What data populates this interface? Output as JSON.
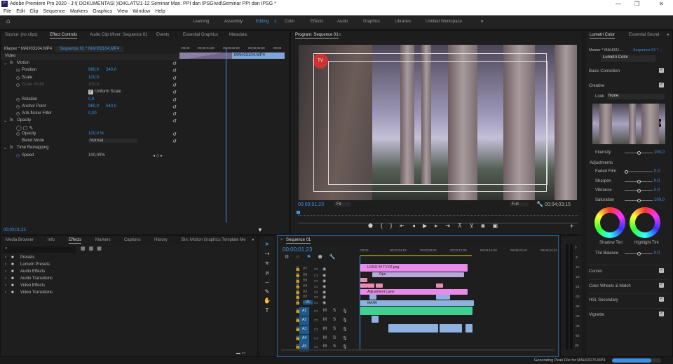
{
  "window": {
    "title": "Adobe Premiere Pro 2020 - J:\\( DOKUMENTASI )\\DIKLAT\\21-12 Seminar Man. PPI dan IPSG\\vid\\Seminar PPI dan IPSG *",
    "app_icon": "Pr"
  },
  "menu": [
    "File",
    "Edit",
    "Clip",
    "Sequence",
    "Markers",
    "Graphics",
    "View",
    "Window",
    "Help"
  ],
  "workspaces": [
    "Learning",
    "Assembly",
    "Editing",
    "Color",
    "Effects",
    "Audio",
    "Graphics",
    "Libraries",
    "Untitled Workspace"
  ],
  "active_workspace": "Editing",
  "source_tabs": [
    "Source: (no clips)",
    "Effect Controls",
    "Audio Clip Mixer: Sequence 01",
    "Events",
    "Essential Graphics",
    "Metadata"
  ],
  "effect_controls": {
    "master": "Master * MAH03104.MP4",
    "sequence": "Sequence 01 * MAH03104.MP4",
    "section": "Video",
    "mini_ruler": [
      ";00;00",
      "00;00;01;00",
      "00;00;02;00",
      "00;00;03;00",
      "00;00"
    ],
    "clip_name": "MAH03104.MP4",
    "rows": [
      {
        "label": "Motion",
        "fx": true
      },
      {
        "label": "Position",
        "v1": "960,0",
        "v2": "540,0"
      },
      {
        "label": "Scale",
        "v1": "100,0"
      },
      {
        "label": "Scale Width",
        "v1": "100,0",
        "disabled": true
      },
      {
        "label": "Uniform Scale"
      },
      {
        "label": "Rotation",
        "v1": "0,0"
      },
      {
        "label": "Anchor Point",
        "v1": "960,0",
        "v2": "540,0"
      },
      {
        "label": "Anti-flicker Filter",
        "v1": "0,00"
      },
      {
        "label": "Opacity",
        "fx": true
      },
      {
        "label": "Opacity",
        "v1": "100,0 %"
      },
      {
        "label": "Blend Mode",
        "v1": "Normal"
      },
      {
        "label": "Time Remapping",
        "fx": true
      },
      {
        "label": "Speed",
        "v1": "100,00%"
      }
    ],
    "timecode": "00;00;01;23"
  },
  "program": {
    "title": "Program: Sequence 01",
    "timecode": "00;00;01;23",
    "fit": "Fit",
    "quality": "Full",
    "duration": "00;04;03;15",
    "logo_text": "TV"
  },
  "lumetri": {
    "tabs": [
      "Lumetri Color",
      "Essential Sound"
    ],
    "master": "Master * MAH031...",
    "sequence": "Sequence 01 * ...",
    "effect": "Lumetri Color",
    "basic": "Basic Correction",
    "creative": "Creative",
    "look_label": "Look",
    "look_value": "None",
    "intensity_label": "Intensity",
    "intensity": "100,0",
    "adjustments": "Adjustments",
    "sliders": [
      {
        "label": "Faded Film",
        "value": "0,0"
      },
      {
        "label": "Sharpen",
        "value": "0,0"
      },
      {
        "label": "Vibrance",
        "value": "0,0"
      },
      {
        "label": "Saturation",
        "value": "100,0"
      }
    ],
    "shadow_tint": "Shadow Tint",
    "highlight_tint": "Highlight Tint",
    "tint_balance": "Tint Balance",
    "tint_value": "0,0",
    "sections": [
      "Curves",
      "Color Wheels & Match",
      "HSL Secondary",
      "Vignette"
    ]
  },
  "effects_panel": {
    "tabs": [
      "Media Browser",
      "Info",
      "Effects",
      "Markers",
      "Captions",
      "History",
      "Bin: Motion Graphics Template Me"
    ],
    "folders": [
      "Presets",
      "Lumetri Presets",
      "Audio Effects",
      "Audio Transitions",
      "Video Effects",
      "Video Transitions"
    ]
  },
  "timeline": {
    "title": "Sequence 01",
    "timecode": "00;00;01;23",
    "ruler": [
      ";00;00",
      "00;01;04;02",
      "00;02;08;04",
      "00;03;12;06",
      "00;04;16;08",
      "00;05;20;10",
      "00;06;24;12"
    ],
    "video_tracks": [
      "V7",
      "V6",
      "V5",
      "V4",
      "V3",
      "V2",
      "V1"
    ],
    "audio_tracks": [
      "A1",
      "A2",
      "A3",
      "A4",
      "A5"
    ],
    "clips": {
      "v7": "LOGO IH TV-02.png",
      "v6": "Ope",
      "v3": "Adjustment Layer",
      "v1": "MAH0"
    },
    "level_labels": [
      "0",
      "-6",
      "-12",
      "-18",
      "-24",
      "-30",
      "-36",
      "-42",
      "-48",
      "-54",
      "dB"
    ]
  },
  "status": {
    "text": "Generating Peak File for MAH03176.MP4",
    "progress": 0.8
  }
}
